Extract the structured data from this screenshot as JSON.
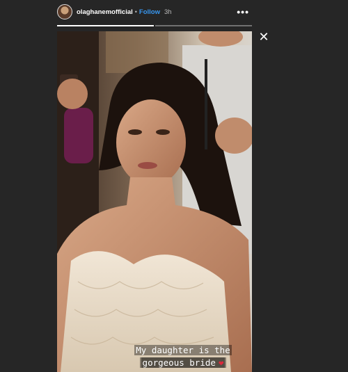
{
  "header": {
    "username": "olaghanemofficial",
    "separator": "•",
    "follow_label": "Follow",
    "time": "3h",
    "more_label": "•••"
  },
  "progress": {
    "segments": 2,
    "current": 1
  },
  "close_label": "✕",
  "caption": {
    "line1": "My daughter is the",
    "line2": "gorgeous bride",
    "heart": "❤"
  },
  "colors": {
    "background": "#262626",
    "follow": "#3897f0",
    "heart": "#e0263a"
  },
  "icons": [
    "avatar",
    "more-icon",
    "close-icon",
    "heart-icon"
  ]
}
